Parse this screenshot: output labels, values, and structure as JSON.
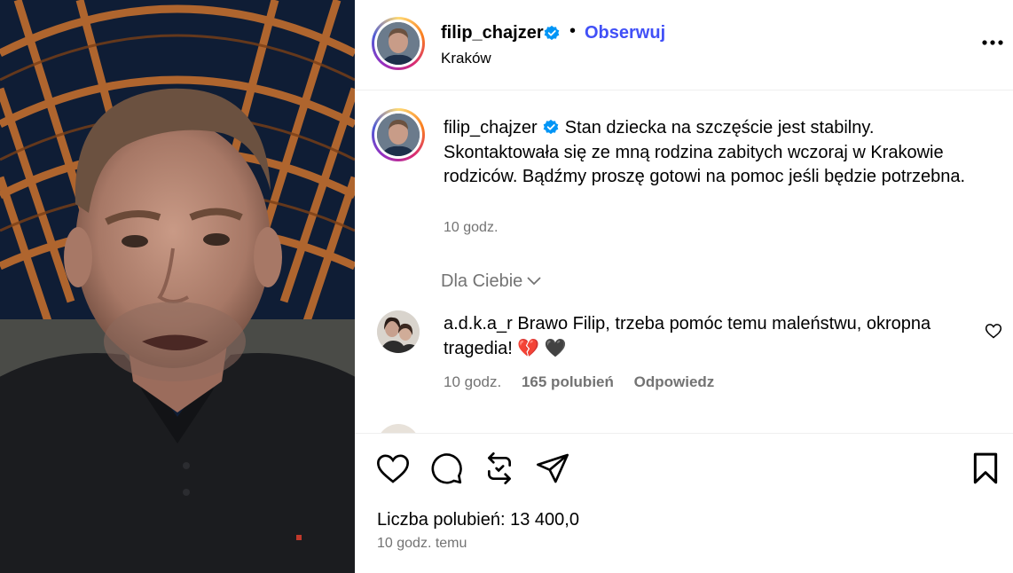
{
  "header": {
    "username": "filip_chajzer",
    "follow_label": "Obserwuj",
    "separator": "•",
    "location": "Kraków"
  },
  "caption": {
    "username": "filip_chajzer",
    "text": "Stan dziecka na szczęście jest stabilny. Skontaktowała się ze mną rodzina zabitych wczoraj w Krakowie rodziców. Bądźmy proszę gotowi na pomoc jeśli będzie potrzebna.",
    "time": "10 godz."
  },
  "filter": {
    "label": "Dla Ciebie"
  },
  "comments": [
    {
      "username": "a.d.k.a_r",
      "text": "Brawo Filip, trzeba pomóc temu maleństwu, okropna tragedia! 💔 🖤",
      "time": "10 godz.",
      "likes": "165 polubień",
      "reply_label": "Odpowiedz"
    }
  ],
  "post": {
    "likes_label": "Liczba polubień: 13 400,0",
    "time_ago": "10 godz. temu"
  },
  "icons": {
    "verified": "verified-badge-icon",
    "more": "more-options-icon",
    "like": "heart-icon",
    "comment": "comment-icon",
    "share": "repost-icon",
    "send": "send-icon",
    "save": "bookmark-icon"
  },
  "colors": {
    "accent": "#4150f7",
    "verified": "#0095f6",
    "muted": "#737373"
  }
}
